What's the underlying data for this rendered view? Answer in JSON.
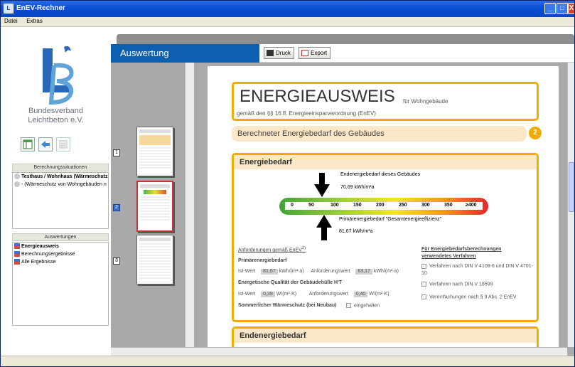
{
  "window": {
    "title": "EnEV-Rechner",
    "min_label": "_",
    "max_label": "□",
    "close_label": "X"
  },
  "menu": {
    "items": [
      "Datei",
      "Extras"
    ]
  },
  "sidebar": {
    "org_line1": "Bundesverband",
    "org_line2": "Leichtbeton e.V.",
    "situations_header": "Berechnungssituationen",
    "situations": [
      "Testhaus / Wohnhaus (Wärmeschutz",
      "- (Wärmeschutz von Wohngebäuden n"
    ],
    "results_header": "Auswertungen",
    "results": [
      "Energieausweis",
      "Berechnungsergebnisse",
      "Alle Ergebnisse"
    ]
  },
  "header": {
    "section_title": "Auswertung",
    "print_label": "Druck",
    "export_label": "Export"
  },
  "thumbnails": {
    "pages": [
      "1",
      "2",
      "3"
    ],
    "selected": "2"
  },
  "document": {
    "title": "ENERGIEAUSWEIS",
    "title_suffix": "für Wohngebäude",
    "subtitle": "gemäß den §§ 16 ff. Energieeinsparverordnung (EnEV)",
    "section_label": "Berechneter Energiebedarf des Gebäudes",
    "section_number": "2",
    "energy_header": "Energiebedarf",
    "end_energy_caption": "Endenergiebedarf dieses Gebäudes",
    "end_energy_value": "70,69 kWh/m²a",
    "scale_ticks": [
      "0",
      "50",
      "100",
      "150",
      "200",
      "250",
      "300",
      "350",
      "≥400"
    ],
    "primary_caption": "Primärenergiebedarf \"Gesamtenergieeffizienz\"",
    "primary_value": "81,67 kWh/m²a",
    "req_title": "Anforderungen gemäß EnEV",
    "req_title_sup": "2)",
    "req_primary": "Primärenergiebedarf",
    "ist_label": "Ist-Wert",
    "ist_value_1": "81,67",
    "unit_1": "kWh/(m²·a)",
    "anf_label": "Anforderungswert",
    "anf_value_1": "83,17",
    "req_envelope": "Energetische Qualität der Gebäudehülle H'T",
    "ist_value_2": "0,39",
    "unit_2": "W/(m²·K)",
    "anf_value_2": "0,40",
    "summer": "Sommerlicher Wärmeschutz (bei Neubau)",
    "summer_check": "eingehalten",
    "methods_title": "Für Energiebedarfsberechnungen verwendetes Verfahren",
    "methods": [
      "Verfahren nach DIN V 4108-6 und DIN V 4701-10",
      "Verfahren nach DIN V 18599",
      "Vereinfachungen nach § 9 Abs. 2 EnEV"
    ],
    "end_header": "Endenergiebedarf"
  },
  "colors": {
    "accent_orange": "#f0ac00",
    "title_blue": "#0d5fb0",
    "selected_red": "#c83232"
  }
}
